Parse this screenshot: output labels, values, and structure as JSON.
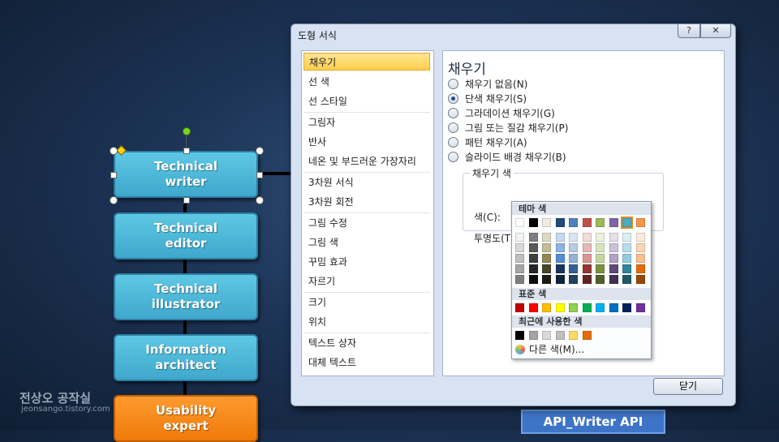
{
  "slide": {
    "boxes": [
      {
        "label": "Technical\nwriter",
        "color": "#4fb8d8"
      },
      {
        "label": "Technical\neditor",
        "color": "#4fb8d8"
      },
      {
        "label": "Technical\nillustrator",
        "color": "#4fb8d8"
      },
      {
        "label": "Information\narchitect",
        "color": "#4fb8d8"
      },
      {
        "label": "Usability\nexpert",
        "color": "#f58a1f"
      }
    ],
    "api_box": "API_Writer API",
    "watermark": "전상오 공작실",
    "watermark_url": "jeonsango.tistory.com"
  },
  "dialog": {
    "title": "도형 서식",
    "help_glyph": "?",
    "close_glyph": "✕",
    "nav": [
      "채우기",
      "선 색",
      "선 스타일",
      "그림자",
      "반사",
      "네온 및 부드러운 가장자리",
      "3차원 서식",
      "3차원 회전",
      "그림 수정",
      "그림 색",
      "꾸밈 효과",
      "자르기",
      "크기",
      "위치",
      "텍스트 상자",
      "대체 텍스트"
    ],
    "selected_nav": "채우기",
    "section_title": "채우기",
    "options": [
      "채우기 없음(N)",
      "단색 채우기(S)",
      "그라데이션 채우기(G)",
      "그림 또는 질감 채우기(P)",
      "패턴 채우기(A)",
      "슬라이드 배경 채우기(B)"
    ],
    "selected_option": "단색 채우기(S)",
    "fill_color_group": "채우기 색",
    "color_label": "색(C):",
    "transparency_label": "투명도(T)",
    "close_button": "닫기"
  },
  "palette": {
    "theme_header": "테마 색",
    "standard_header": "표준 색",
    "recent_header": "최근에 사용한 색",
    "more_colors": "다른 색(M)...",
    "theme_top": [
      "#ffffff",
      "#000000",
      "#eeece1",
      "#1f497d",
      "#4f81bd",
      "#c0504d",
      "#9bbb59",
      "#8064a2",
      "#4bacc6",
      "#f79646"
    ],
    "theme_shades": [
      [
        "#f2f2f2",
        "#7f7f7f",
        "#ddd9c3",
        "#c6d9f0",
        "#dbe5f1",
        "#f2dcdb",
        "#ebf1dd",
        "#e5e0ec",
        "#dbeef3",
        "#fdeada"
      ],
      [
        "#d8d8d8",
        "#595959",
        "#c4bd97",
        "#8db3e2",
        "#b8cce4",
        "#e5b9b7",
        "#d7e3bc",
        "#ccc1d9",
        "#b7dde8",
        "#fbd5b5"
      ],
      [
        "#bfbfbf",
        "#3f3f3f",
        "#938953",
        "#548dd4",
        "#95b3d7",
        "#d99694",
        "#c3d69b",
        "#b2a2c7",
        "#92cddc",
        "#fac08f"
      ],
      [
        "#a5a5a5",
        "#262626",
        "#494429",
        "#17365d",
        "#366092",
        "#953734",
        "#76923c",
        "#5f497a",
        "#31859b",
        "#e36c09"
      ],
      [
        "#7f7f7f",
        "#0c0c0c",
        "#1d1b10",
        "#0f243e",
        "#244061",
        "#632423",
        "#4f6128",
        "#3f3151",
        "#205867",
        "#974806"
      ]
    ],
    "standard": [
      "#c00000",
      "#ff0000",
      "#ffc000",
      "#ffff00",
      "#92d050",
      "#00b050",
      "#00b0f0",
      "#0070c0",
      "#002060",
      "#7030a0"
    ],
    "recent": [
      "#000000",
      "#a5a5a5",
      "#d8d8d8",
      "#bfbfbf",
      "#ffd966",
      "#e46c0a"
    ],
    "selected_color": "#4bacc6"
  }
}
